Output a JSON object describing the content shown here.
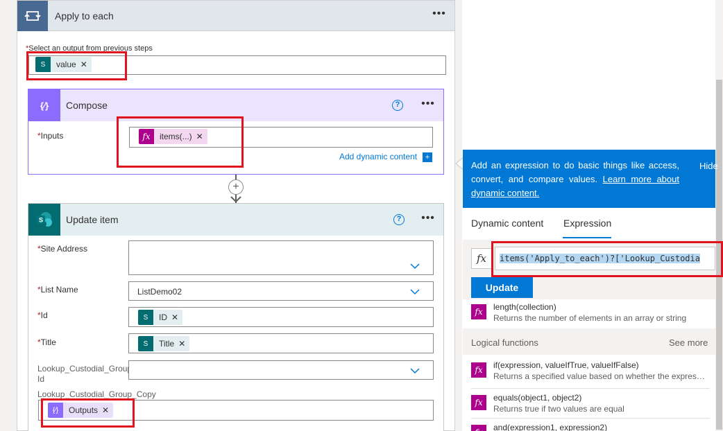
{
  "apply_to_each": {
    "title": "Apply to each",
    "field_label": "Select an output from previous steps",
    "token": "value"
  },
  "compose": {
    "title": "Compose",
    "inputs_label": "Inputs",
    "token": "items(...)",
    "add_dynamic": "Add dynamic content"
  },
  "update_item": {
    "title": "Update item",
    "fields": {
      "site_address": "Site Address",
      "list_name": "List Name",
      "list_name_value": "ListDemo02",
      "id": "Id",
      "id_token": "ID",
      "title": "Title",
      "title_token": "Title",
      "lookup_id_line1": "Lookup_Custodial_Group",
      "lookup_id_line2": "Id",
      "lookup_copy": "Lookup_Custodial_Group_Copy",
      "lookup_copy_token": "Outputs"
    }
  },
  "panel": {
    "info_text": "Add an expression to do basic things like access, convert, and compare values.",
    "info_link": "Learn more about dynamic content.",
    "hide": "Hide",
    "tabs": [
      "Dynamic content",
      "Expression"
    ],
    "active_tab": "Expression",
    "expression": "items('Apply_to_each')?['Lookup_Custodia",
    "update_button": "Update",
    "functions": [
      {
        "name": "length(collection)",
        "desc": "Returns the number of elements in an array or string"
      }
    ],
    "logical_section": "Logical functions",
    "see_more": "See more",
    "logical_functions": [
      {
        "name": "if(expression, valueIfTrue, valueIfFalse)",
        "desc": "Returns a specified value based on whether the expressio..."
      },
      {
        "name": "equals(object1, object2)",
        "desc": "Returns true if two values are equal"
      },
      {
        "name": "and(expression1, expression2)",
        "desc": ""
      }
    ]
  },
  "colors": {
    "highlight": "#e1141e",
    "accent": "#0078d4",
    "sharepoint": "#036c70",
    "compose": "#8c6cff",
    "function": "#ad008c"
  }
}
